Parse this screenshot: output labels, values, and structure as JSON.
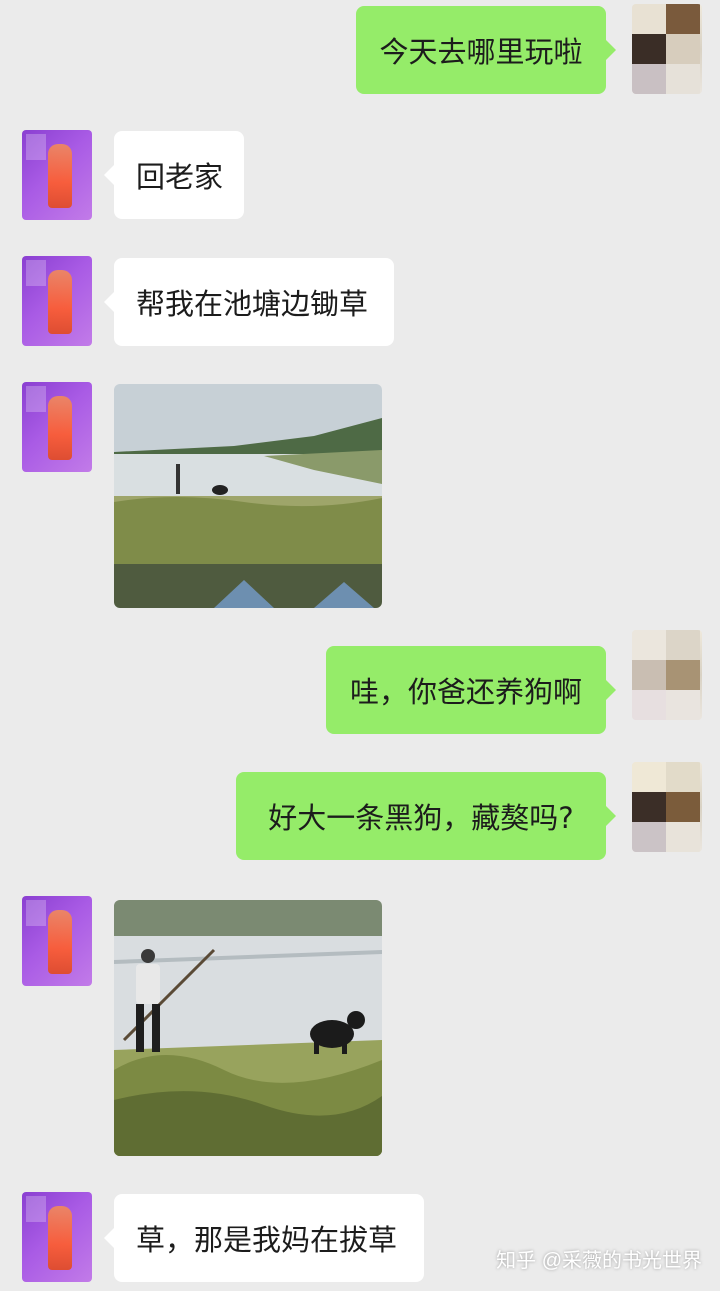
{
  "messages": [
    {
      "side": "out",
      "text": "今天去哪里玩啦"
    },
    {
      "side": "in",
      "text": "回老家"
    },
    {
      "side": "in",
      "text": "帮我在池塘边锄草"
    },
    {
      "side": "in",
      "type": "image",
      "content": "pond-scene-image"
    },
    {
      "side": "out",
      "text": "哇，你爸还养狗啊"
    },
    {
      "side": "out",
      "text": "好大一条黑狗，藏獒吗?"
    },
    {
      "side": "in",
      "type": "image",
      "content": "person-and-dog-image"
    },
    {
      "side": "in",
      "text": "草，那是我妈在拔草"
    }
  ],
  "watermark": "知乎 @采薇的书光世界",
  "colors": {
    "background": "#ebebeb",
    "outgoing_bubble": "#95ec69",
    "incoming_bubble": "#ffffff",
    "text": "#1c1c1c"
  }
}
